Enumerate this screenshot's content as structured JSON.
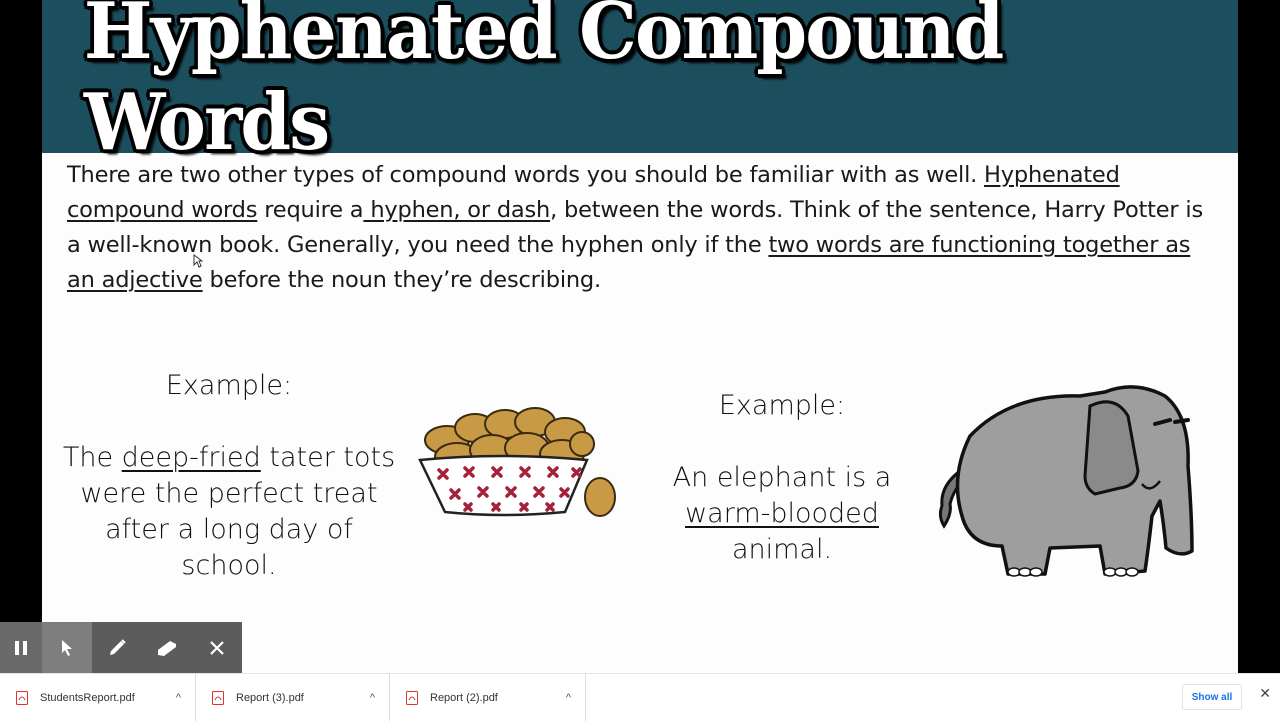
{
  "slide": {
    "title": "Hyphenated Compound Words",
    "intro": {
      "p1": "There are two other types of compound words you should be familiar with as well. ",
      "u1": "Hyphenated compound words",
      "p2": " require a",
      "u2": " hyphen, or dash",
      "p3": ", between the words. Think of the sentence, Harry Potter is a well-known book. Generally, you need the hyphen only if the ",
      "u3": "two words are functioning together as an adjective",
      "p4": " before the noun they’re describing."
    },
    "example1": {
      "label": "Example:",
      "pre": "The ",
      "term": "deep-fried",
      "post": " tater tots were the perfect treat after a long day of school.",
      "image": "tater-tots-basket"
    },
    "example2": {
      "label": "Example:",
      "pre": "An elephant is a ",
      "term": "warm-blooded",
      "post": " animal.",
      "image": "cartoon-elephant"
    }
  },
  "toolbar": {
    "items": [
      {
        "name": "pause",
        "icon": "pause-icon"
      },
      {
        "name": "pointer",
        "icon": "pointer-icon",
        "active": true
      },
      {
        "name": "pen",
        "icon": "pen-icon"
      },
      {
        "name": "eraser",
        "icon": "eraser-icon"
      },
      {
        "name": "close",
        "icon": "close-icon"
      }
    ]
  },
  "downloads": {
    "items": [
      {
        "name": "StudentsReport.pdf"
      },
      {
        "name": "Report (3).pdf"
      },
      {
        "name": "Report (2).pdf"
      }
    ],
    "chevron": "^",
    "show_all": "Show all",
    "close": "✕"
  },
  "colors": {
    "header_bg": "#1c4f5e",
    "basket_red": "#a3223a",
    "tot_gold": "#c99a45",
    "elephant_gray": "#9e9e9e",
    "show_all_blue": "#1a73e8"
  }
}
